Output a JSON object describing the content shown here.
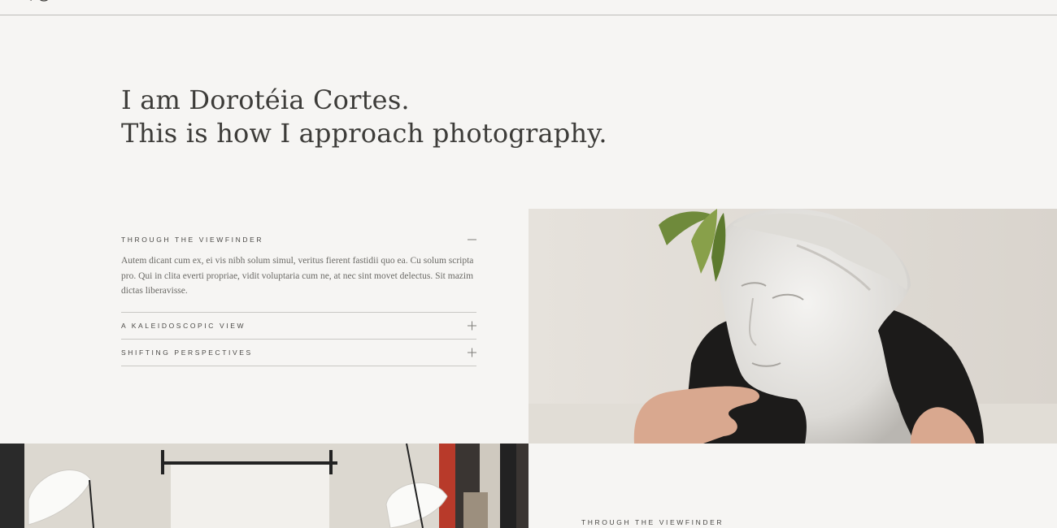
{
  "header": {
    "logo_icon": "monogram-logo-icon"
  },
  "intro": {
    "line1": "I am Dorotéia Cortes.",
    "line2": "This is how I approach photography."
  },
  "accordion": {
    "items": [
      {
        "title": "THROUGH THE VIEWFINDER",
        "expanded": true,
        "toggle_icon": "minus-icon",
        "body": "Autem dicant cum ex, ei vis nibh solum simul, veritus fierent fastidii quo ea. Cu solum scripta pro. Qui in clita everti propriae, vidit voluptaria cum ne, at nec sint movet delectus. Sit mazim dictas liberavisse."
      },
      {
        "title": "A KALEIDOSCOPIC VIEW",
        "expanded": false,
        "toggle_icon": "plus-icon"
      },
      {
        "title": "SHIFTING PERSPECTIVES",
        "expanded": false,
        "toggle_icon": "plus-icon"
      }
    ]
  },
  "images": {
    "statue": "statue-photo",
    "studio": "studio-photo"
  },
  "bottom_section": {
    "label": "THROUGH THE VIEWFINDER"
  },
  "colors": {
    "background": "#f6f5f3",
    "text": "#3d3c39",
    "divider": "#c9c8c4"
  }
}
